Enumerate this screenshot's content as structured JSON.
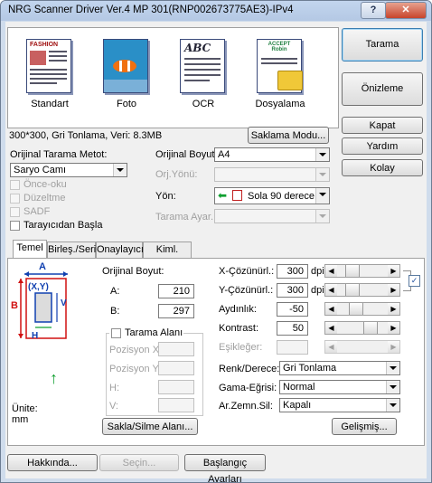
{
  "window": {
    "title": "NRG Scanner Driver Ver.4 MP 301(RNP002673775AE3)-IPv4",
    "help_label": "?",
    "close_label": "✕"
  },
  "modes": [
    {
      "label": "Standart",
      "icon": "document-icon"
    },
    {
      "label": "Foto",
      "icon": "photo-icon"
    },
    {
      "label": "OCR",
      "icon": "ocr-icon"
    },
    {
      "label": "Dosyalama",
      "icon": "folder-icon"
    }
  ],
  "thumb_text": {
    "standart": "FASHION",
    "ocr": "ABC",
    "dosyalama": "ACCEPT Robin"
  },
  "buttons": {
    "tarama": "Tarama",
    "onizleme": "Önizleme",
    "kapat": "Kapat",
    "yardim": "Yardım",
    "kolay": "Kolay",
    "saklama_modu": "Saklama Modu...",
    "sakla_silme": "Sakla/Silme Alanı...",
    "gelismis": "Gelişmiş...",
    "hakkinda": "Hakkında...",
    "secin": "Seçin...",
    "baslangic": "Başlangıç Ayarları"
  },
  "status": "300*300, Gri Tonlama, Veri: 8.3MB",
  "scan_method": {
    "label": "Orijinal Tarama Metot:",
    "value": "Saryo Camı"
  },
  "checkboxes": [
    {
      "label": "Önce-oku",
      "enabled": false,
      "checked": false
    },
    {
      "label": "Düzeltme",
      "enabled": false,
      "checked": false
    },
    {
      "label": "SADF",
      "enabled": false,
      "checked": false
    },
    {
      "label": "Tarayıcıdan Başla",
      "enabled": true,
      "checked": false
    }
  ],
  "orig_size": {
    "label": "Orijinal Boyut:",
    "value": "A4"
  },
  "orig_dir": {
    "label": "Orj.Yönü:",
    "value": ""
  },
  "yon": {
    "label": "Yön:",
    "value": "Sola 90 derece"
  },
  "tarama_ayar": {
    "label": "Tarama Ayar.:",
    "value": ""
  },
  "tabs": [
    "Temel",
    "Birleş./Seri",
    "Onaylayıcı",
    "Kiml. Doğr."
  ],
  "diagram": {
    "a": "A",
    "b": "B",
    "v": "V",
    "h": "H",
    "xy": "(X,Y)"
  },
  "unit": {
    "label": "Ünite:",
    "value": "mm"
  },
  "orig_size_fields": {
    "label": "Orijinal Boyut:",
    "a_label": "A:",
    "a_value": "210",
    "b_label": "B:",
    "b_value": "297"
  },
  "scan_area": {
    "label": "Tarama Alanı",
    "pos_x": "Pozisyon X:",
    "pos_y": "Pozisyon Y:",
    "h": "H:",
    "v": "V:"
  },
  "x_res": {
    "label": "X-Çözünürl.:",
    "value": "300",
    "unit": "dpi"
  },
  "y_res": {
    "label": "Y-Çözünürl.:",
    "value": "300",
    "unit": "dpi"
  },
  "brightness": {
    "label": "Aydınlık:",
    "value": "-50"
  },
  "contrast": {
    "label": "Kontrast:",
    "value": "50"
  },
  "threshold": {
    "label": "Eşikleğer:",
    "value": ""
  },
  "color": {
    "label": "Renk/Derece:",
    "value": "Gri Tonlama"
  },
  "gamma": {
    "label": "Gama-Eğrisi:",
    "value": "Normal"
  },
  "bg_remove": {
    "label": "Ar.Zemn.Sil:",
    "value": "Kapalı"
  },
  "colors": {
    "accent": "#3c7fb1",
    "close": "#c7442c",
    "diagram_red": "#d01010",
    "diagram_blue": "#1040b0",
    "diagram_green": "#10a030"
  }
}
